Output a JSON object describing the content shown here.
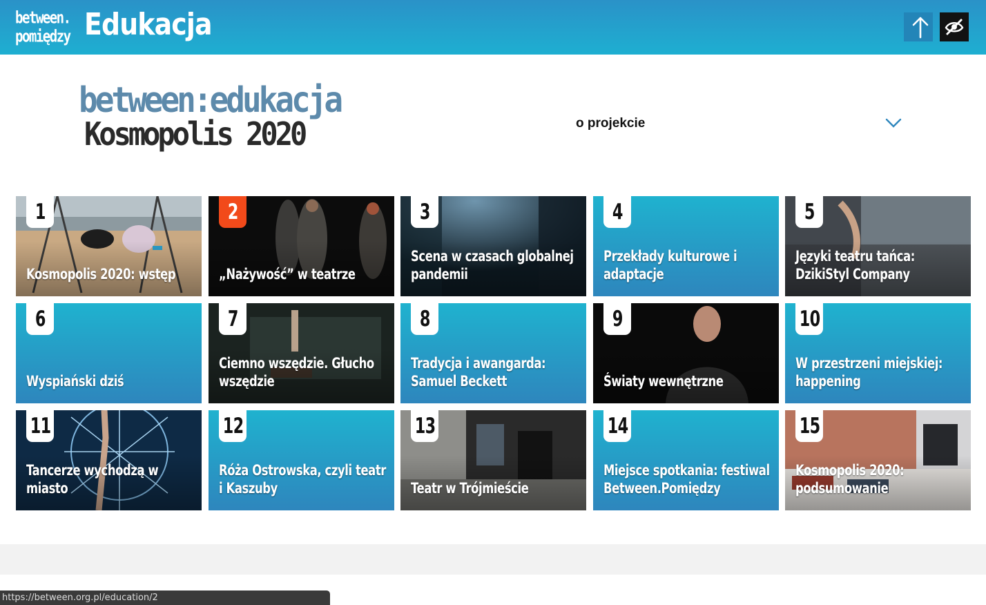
{
  "header": {
    "brand_line1": "between.",
    "brand_line2": "pomiędzy",
    "title": "Edukacja",
    "up_icon": "arrow-up-icon",
    "contrast_icon": "eye-slash-icon"
  },
  "intro": {
    "logo_line1": "between:edukacja",
    "logo_line2": "Kosmopolis 2020",
    "about_label": "o projekcie",
    "chevron_icon": "chevron-down-icon"
  },
  "colors": {
    "accent": "#1fb2cf",
    "accent_dark": "#2e86bd",
    "highlight": "#f24a1a"
  },
  "tiles": [
    {
      "num": "1",
      "title": "Kosmopolis 2020: wstęp",
      "image": "beach-swings"
    },
    {
      "num": "2",
      "title": "„Nażywość” w teatrze",
      "image": "stage-actors",
      "highlighted": true
    },
    {
      "num": "3",
      "title": "Scena w czasach globalnej pandemii",
      "image": "empty-stage"
    },
    {
      "num": "4",
      "title": "Przekłady kulturowe i adaptacje",
      "image": ""
    },
    {
      "num": "5",
      "title": "Języki teatru tańca: DzikiStyl Company",
      "image": "seaside-hand"
    },
    {
      "num": "6",
      "title": "Wyspiański dziś",
      "image": ""
    },
    {
      "num": "7",
      "title": "Ciemno wszędzie. Głucho wszędzie",
      "image": "dark-stage"
    },
    {
      "num": "8",
      "title": "Tradycja i awangarda: Samuel Beckett",
      "image": ""
    },
    {
      "num": "9",
      "title": "Światy wewnętrzne",
      "image": "portrait-man"
    },
    {
      "num": "10",
      "title": "W przestrzeni miejskiej: happening",
      "image": ""
    },
    {
      "num": "11",
      "title": "Tancerze wychodzą w miasto",
      "image": "dancer-light"
    },
    {
      "num": "12",
      "title": "Róża Ostrowska, czyli teatr i Kaszuby",
      "image": ""
    },
    {
      "num": "13",
      "title": "Teatr w Trójmieście",
      "image": "theatre-entrance"
    },
    {
      "num": "14",
      "title": "Miejsce spotkania: festiwal Between.Pomiędzy",
      "image": ""
    },
    {
      "num": "15",
      "title": "Kosmopolis 2020: podsumowanie",
      "image": "book-table"
    }
  ],
  "status_bar": "https://between.org.pl/education/2"
}
